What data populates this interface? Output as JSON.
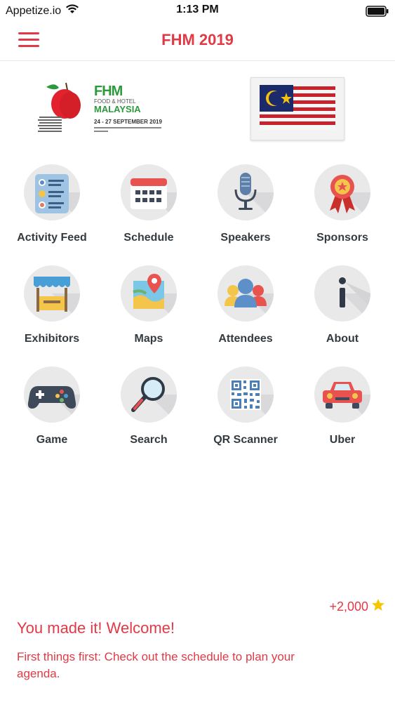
{
  "status_bar": {
    "carrier": "Appetize.io",
    "time": "1:13 PM"
  },
  "nav": {
    "title": "FHM 2019",
    "menu_icon": "hamburger-menu-icon"
  },
  "banner": {
    "logo_brand": "FHM",
    "logo_line1": "FOOD & HOTEL",
    "logo_line2": "MALAYSIA",
    "logo_dates": "24 - 27 SEPTEMBER 2019",
    "flag_image": "malaysia-flag"
  },
  "menu": [
    {
      "label": "Activity Feed",
      "icon": "activity-feed-icon"
    },
    {
      "label": "Schedule",
      "icon": "calendar-icon"
    },
    {
      "label": "Speakers",
      "icon": "microphone-icon"
    },
    {
      "label": "Sponsors",
      "icon": "award-ribbon-icon"
    },
    {
      "label": "Exhibitors",
      "icon": "booth-icon"
    },
    {
      "label": "Maps",
      "icon": "map-pin-icon"
    },
    {
      "label": "Attendees",
      "icon": "people-icon"
    },
    {
      "label": "About",
      "icon": "info-icon"
    },
    {
      "label": "Game",
      "icon": "gamepad-icon"
    },
    {
      "label": "Search",
      "icon": "magnifier-icon"
    },
    {
      "label": "QR Scanner",
      "icon": "qr-code-icon"
    },
    {
      "label": "Uber",
      "icon": "car-icon"
    }
  ],
  "footer": {
    "points": "+2,000",
    "welcome_title": "You made it! Welcome!",
    "welcome_body": "First things first: Check out the schedule to plan your agenda."
  },
  "colors": {
    "accent": "#e03a46",
    "tile_bg": "#e9e9ea",
    "label": "#333a40"
  }
}
